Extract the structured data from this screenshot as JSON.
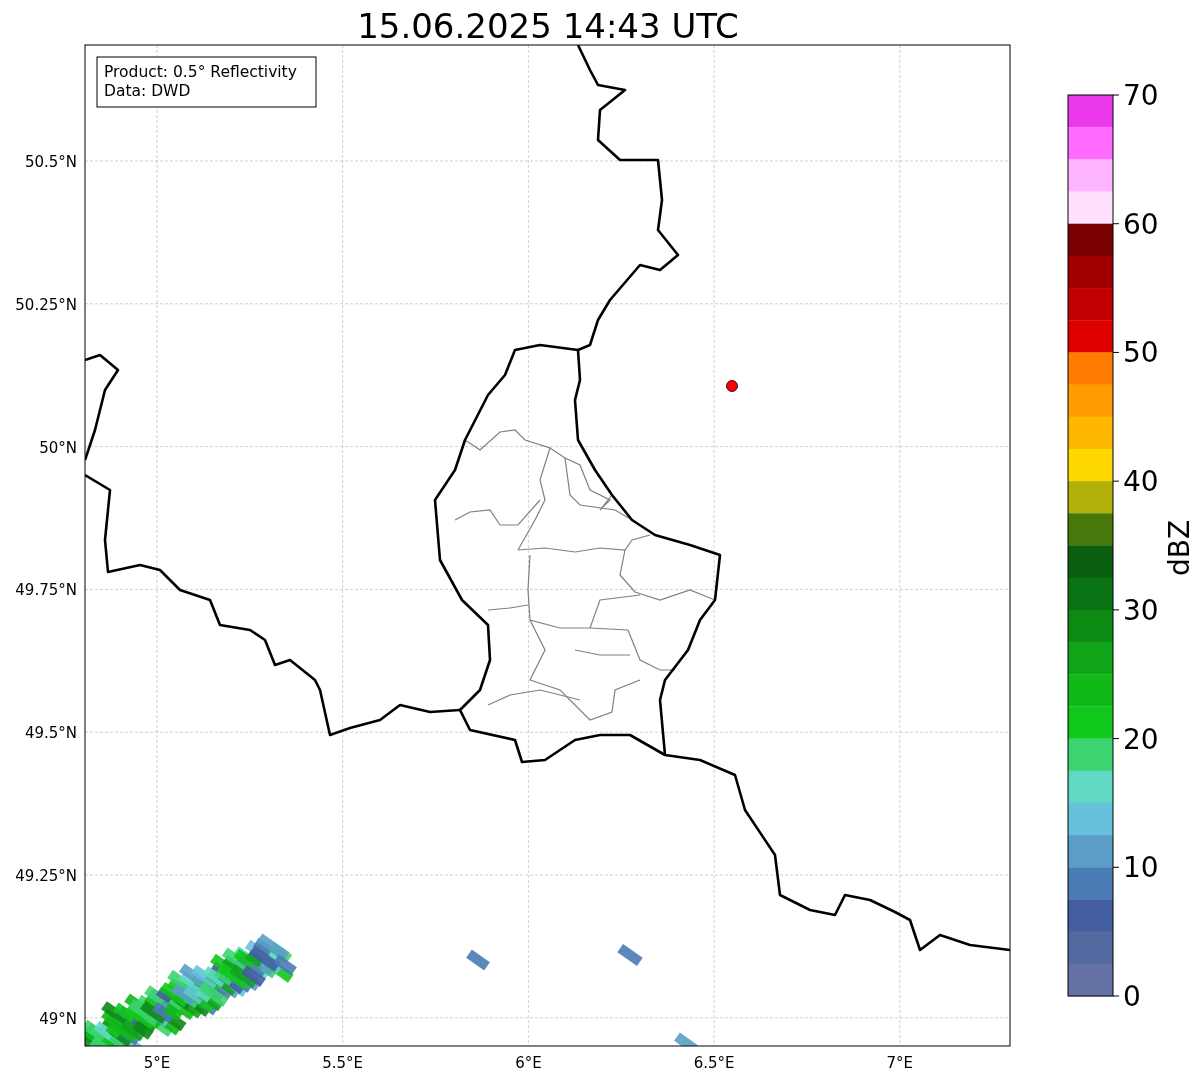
{
  "title": "15.06.2025 14:43 UTC",
  "info_box": [
    "Product: 0.5° Reflectivity",
    "Data: DWD"
  ],
  "map": {
    "lat_ticks": [
      "50.5°N",
      "50.25°N",
      "50°N",
      "49.75°N",
      "49.5°N",
      "49.25°N",
      "49°N"
    ],
    "lon_ticks": [
      "5°E",
      "5.5°E",
      "6°E",
      "6.5°E",
      "7°E"
    ],
    "marker": {
      "color": "#ff0000"
    }
  },
  "colorbar": {
    "label": "dBZ",
    "ticks": [
      "70",
      "60",
      "50",
      "40",
      "30",
      "20",
      "10",
      "0"
    ],
    "bands": [
      {
        "color": "#ea38ea"
      },
      {
        "color": "#ff6cff"
      },
      {
        "color": "#ffb4ff"
      },
      {
        "color": "#ffe0ff"
      },
      {
        "color": "#780000"
      },
      {
        "color": "#a00000"
      },
      {
        "color": "#c00000"
      },
      {
        "color": "#e00000"
      },
      {
        "color": "#ff7c00"
      },
      {
        "color": "#ff9c00"
      },
      {
        "color": "#ffb800"
      },
      {
        "color": "#ffd800"
      },
      {
        "color": "#b0b008"
      },
      {
        "color": "#48780c"
      },
      {
        "color": "#0a5e10"
      },
      {
        "color": "#0a7414"
      },
      {
        "color": "#0c8a14"
      },
      {
        "color": "#10a418"
      },
      {
        "color": "#10b818"
      },
      {
        "color": "#10c81a"
      },
      {
        "color": "#3cd470"
      },
      {
        "color": "#60d8c4"
      },
      {
        "color": "#66c2dc"
      },
      {
        "color": "#5a9ec8"
      },
      {
        "color": "#4a7bb4"
      },
      {
        "color": "#425da0"
      },
      {
        "color": "#52689e"
      },
      {
        "color": "#6472a6"
      }
    ]
  }
}
